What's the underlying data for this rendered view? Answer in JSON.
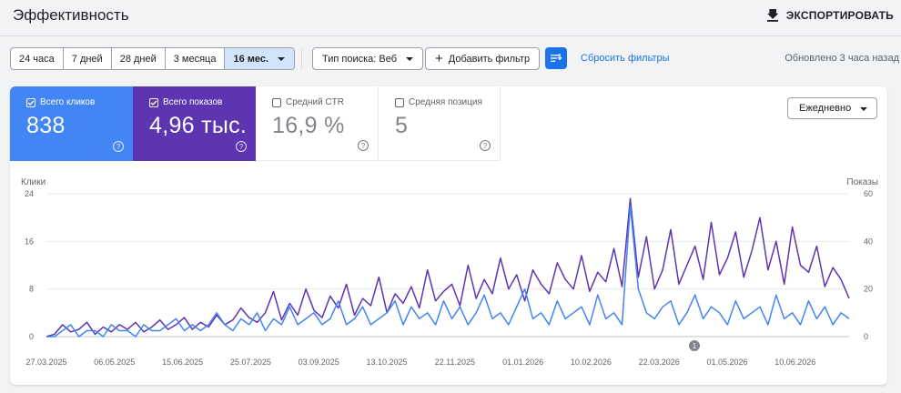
{
  "header": {
    "title": "Эффективность",
    "export_label": "ЭКСПОРТИРОВАТЬ"
  },
  "filters": {
    "ranges": [
      "24 часа",
      "7 дней",
      "28 дней",
      "3 месяца",
      "16 мес."
    ],
    "active_range": "16 мес.",
    "search_type": "Тип поиска: Веб",
    "add_filter": "Добавить фильтр",
    "reset": "Сбросить фильтры",
    "updated": "Обновлено 3 часа назад"
  },
  "metrics": [
    {
      "label": "Всего кликов",
      "value": "838",
      "checked": true
    },
    {
      "label": "Всего показов",
      "value": "4,96 тыс.",
      "checked": true
    },
    {
      "label": "Средний CTR",
      "value": "16,9 %",
      "checked": false
    },
    {
      "label": "Средняя позиция",
      "value": "5",
      "checked": false
    }
  ],
  "granularity": "Ежедневно",
  "colors": {
    "clicks": "#4285f4",
    "impressions": "#5e35b1",
    "accent": "#1a73e8"
  },
  "chart_data": {
    "type": "line",
    "y_left_title": "Клики",
    "y_right_title": "Показы",
    "y_left_ticks": [
      "24",
      "16",
      "8",
      "0"
    ],
    "y_right_ticks": [
      "60",
      "40",
      "20",
      "0"
    ],
    "ylim_left": [
      0,
      24
    ],
    "ylim_right": [
      0,
      60
    ],
    "x_ticks": [
      "27.03.2025",
      "06.05.2025",
      "15.06.2025",
      "25.07.2025",
      "03.09.2025",
      "13.10.2025",
      "22.11.2025",
      "01.01.2026",
      "10.02.2026",
      "22.03.2026",
      "01.05.2026",
      "10.06.2026"
    ],
    "annotation": "1",
    "annotation_date": "01.05.2026",
    "series": [
      {
        "name": "Клики",
        "axis": "left",
        "values": [
          0,
          0,
          1,
          2,
          0,
          1,
          1,
          0,
          2,
          1,
          1,
          0,
          2,
          1,
          1,
          2,
          3,
          1,
          2,
          1,
          2,
          4,
          2,
          1,
          3,
          2,
          4,
          1,
          3,
          2,
          5,
          2,
          3,
          4,
          2,
          3,
          6,
          2,
          3,
          5,
          2,
          3,
          4,
          6,
          2,
          5,
          3,
          4,
          2,
          6,
          3,
          5,
          2,
          4,
          7,
          3,
          4,
          2,
          5,
          8,
          3,
          4,
          2,
          6,
          3,
          4,
          5,
          2,
          7,
          3,
          4,
          2,
          22,
          8,
          4,
          3,
          5,
          6,
          2,
          4,
          7,
          3,
          5,
          4,
          2,
          6,
          3,
          4,
          5,
          2,
          7,
          3,
          4,
          2,
          6,
          3,
          5,
          2,
          4,
          3
        ]
      },
      {
        "name": "Показы",
        "axis": "right",
        "values": [
          0,
          1,
          5,
          2,
          3,
          6,
          1,
          4,
          2,
          5,
          3,
          6,
          2,
          4,
          7,
          3,
          5,
          8,
          3,
          6,
          4,
          9,
          5,
          7,
          12,
          8,
          6,
          10,
          19,
          7,
          14,
          9,
          20,
          11,
          8,
          17,
          12,
          22,
          9,
          16,
          13,
          25,
          10,
          18,
          14,
          21,
          12,
          28,
          15,
          19,
          22,
          13,
          30,
          16,
          24,
          18,
          33,
          20,
          26,
          15,
          28,
          22,
          18,
          31,
          24,
          20,
          34,
          19,
          27,
          23,
          37,
          21,
          58,
          25,
          42,
          20,
          28,
          45,
          22,
          30,
          38,
          24,
          48,
          26,
          33,
          44,
          25,
          36,
          50,
          28,
          40,
          22,
          46,
          30,
          27,
          38,
          21,
          29,
          24,
          16
        ]
      }
    ]
  }
}
